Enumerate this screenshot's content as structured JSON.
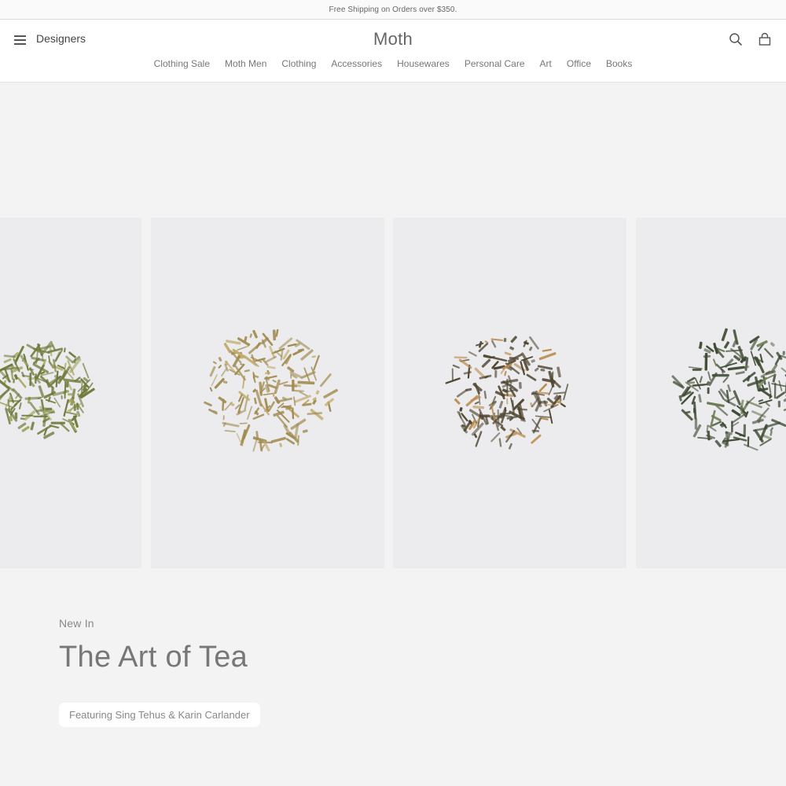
{
  "announcement": "Free Shipping on Orders over $350.",
  "header": {
    "designers_label": "Designers",
    "logo": "Moth",
    "icons": [
      "menu-icon",
      "search-icon",
      "bag-icon"
    ]
  },
  "nav": [
    "Clothing Sale",
    "Moth Men",
    "Clothing",
    "Accessories",
    "Housewares",
    "Personal Care",
    "Art",
    "Office",
    "Books"
  ],
  "hero": {
    "eyebrow": "New In",
    "title": "The Art of Tea",
    "cta": "Featuring Sing Tehus & Karin Carlander"
  },
  "carousel": [
    {
      "name": "green-tea-leaves",
      "leaf_color": "#6e7a3a",
      "accent": "#a6a560"
    },
    {
      "name": "hojicha-stems",
      "leaf_color": "#a08a4e",
      "accent": "#c2ab6c"
    },
    {
      "name": "black-tea-leaves",
      "leaf_color": "#4f4530",
      "accent": "#b98c4c"
    },
    {
      "name": "sencha-leaves",
      "leaf_color": "#3e4a33",
      "accent": "#6a7a52"
    }
  ]
}
